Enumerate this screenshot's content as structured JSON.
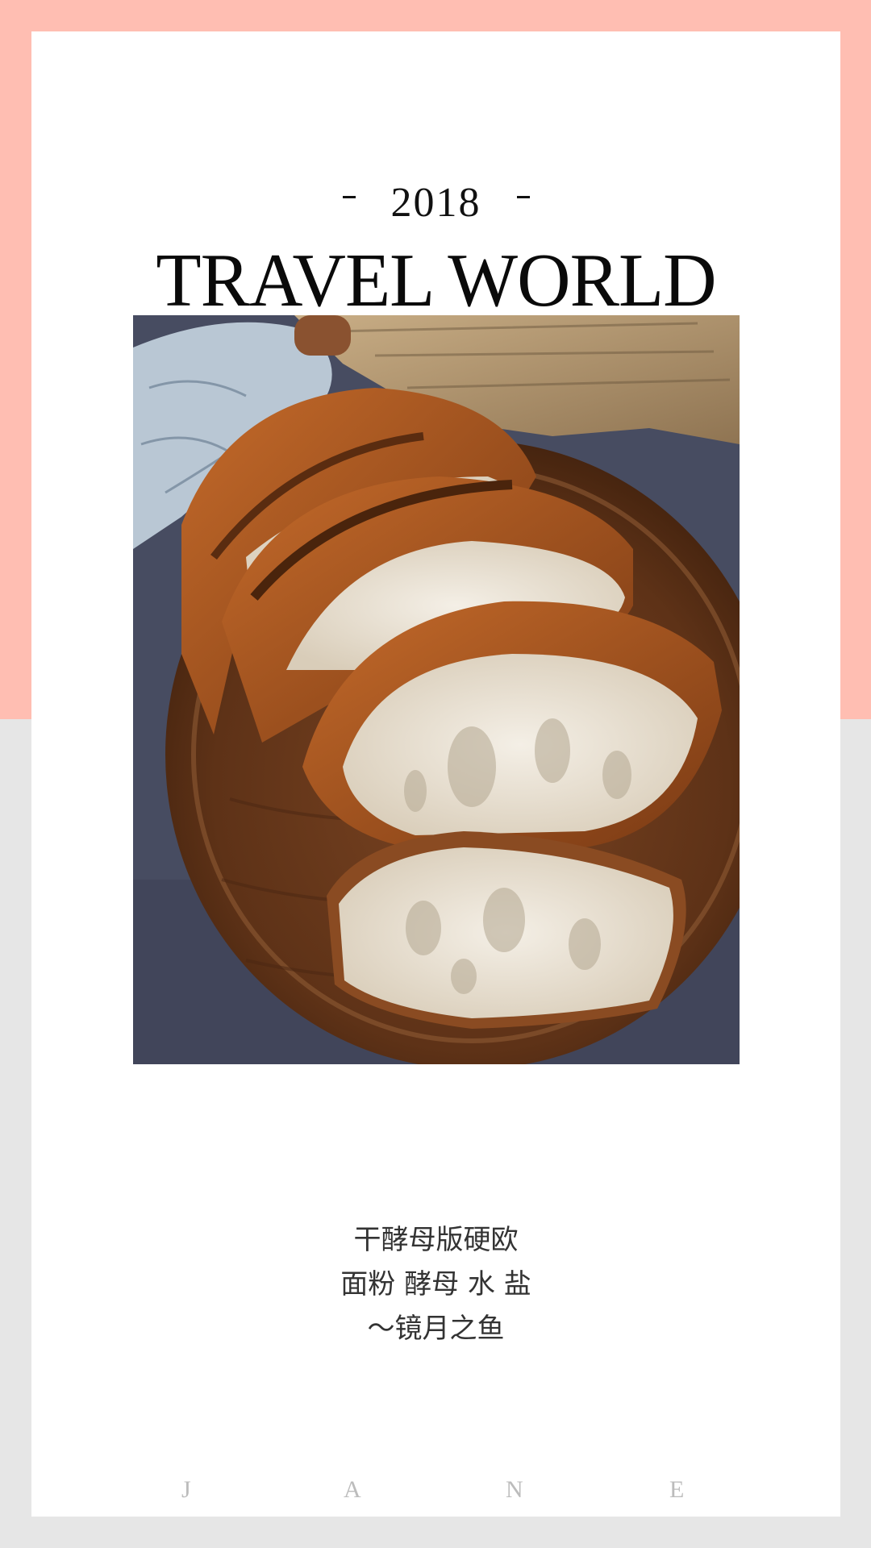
{
  "colors": {
    "top_band": "#ffbeb2",
    "bottom_band": "#e6e6e6",
    "card": "#ffffff",
    "text": "#111111",
    "signature": "#bcbcbc"
  },
  "header": {
    "year": "2018",
    "title": "TRAVEL WORLD"
  },
  "photo": {
    "icon": "bread-photo"
  },
  "caption": {
    "line1": "干酵母版硬欧",
    "line2": "面粉 酵母 水 盐",
    "line3": "～镜月之鱼"
  },
  "signature": {
    "letters": [
      "J",
      "A",
      "N",
      "E"
    ]
  }
}
